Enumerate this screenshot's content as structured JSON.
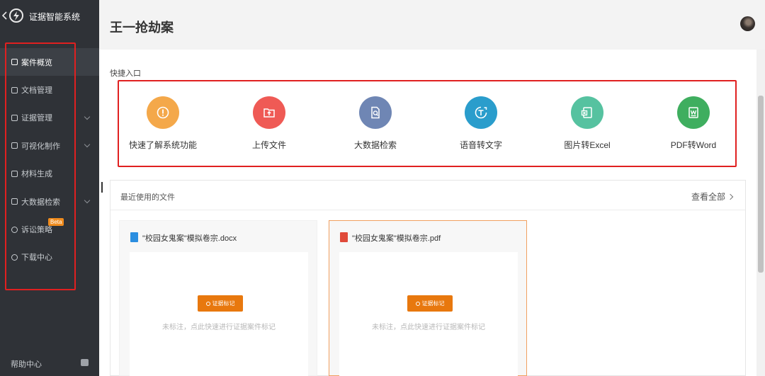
{
  "sidebar": {
    "app_title": "证据智能系统",
    "items": [
      {
        "label": "案件概览",
        "active": true,
        "has_children": false
      },
      {
        "label": "文档管理",
        "active": false,
        "has_children": false
      },
      {
        "label": "证据管理",
        "active": false,
        "has_children": true
      },
      {
        "label": "可视化制作",
        "active": false,
        "has_children": true
      },
      {
        "label": "材料生成",
        "active": false,
        "has_children": false
      },
      {
        "label": "大数据检索",
        "active": false,
        "has_children": true
      },
      {
        "label": "诉讼策略",
        "active": false,
        "has_children": false,
        "badge": "Beta"
      },
      {
        "label": "下载中心",
        "active": false,
        "has_children": false
      }
    ],
    "help_label": "帮助中心"
  },
  "header": {
    "page_title": "王一抢劫案"
  },
  "quick_entry": {
    "title": "快捷入口",
    "items": [
      {
        "label": "快速了解系统功能",
        "icon": "info-icon",
        "color": "#f4a84a"
      },
      {
        "label": "上传文件",
        "icon": "upload-folder-icon",
        "color": "#ef5a55"
      },
      {
        "label": "大数据检索",
        "icon": "document-search-icon",
        "color": "#6f86b4"
      },
      {
        "label": "语音转文字",
        "icon": "speech-to-text-icon",
        "color": "#2a9dcc"
      },
      {
        "label": "图片转Excel",
        "icon": "image-to-excel-icon",
        "color": "#56c2a0"
      },
      {
        "label": "PDF转Word",
        "icon": "pdf-to-word-icon",
        "color": "#3fae5f"
      }
    ]
  },
  "recent_files": {
    "title": "最近使用的文件",
    "view_all": "查看全部",
    "files": [
      {
        "name": "\"校园女鬼案\"模拟卷宗.docx",
        "type": "docx",
        "icon_color": "#2b8ee0",
        "button": "证据标记",
        "hint": "未标注，点此快速进行证据案件标记"
      },
      {
        "name": "\"校园女鬼案\"模拟卷宗.pdf",
        "type": "pdf",
        "icon_color": "#e04a3a",
        "button": "证据标记",
        "hint": "未标注，点此快速进行证据案件标记"
      }
    ]
  },
  "colors": {
    "sidebar_bg": "#2f3237",
    "accent_orange": "#e8780e",
    "annotation_red": "#e02020"
  }
}
